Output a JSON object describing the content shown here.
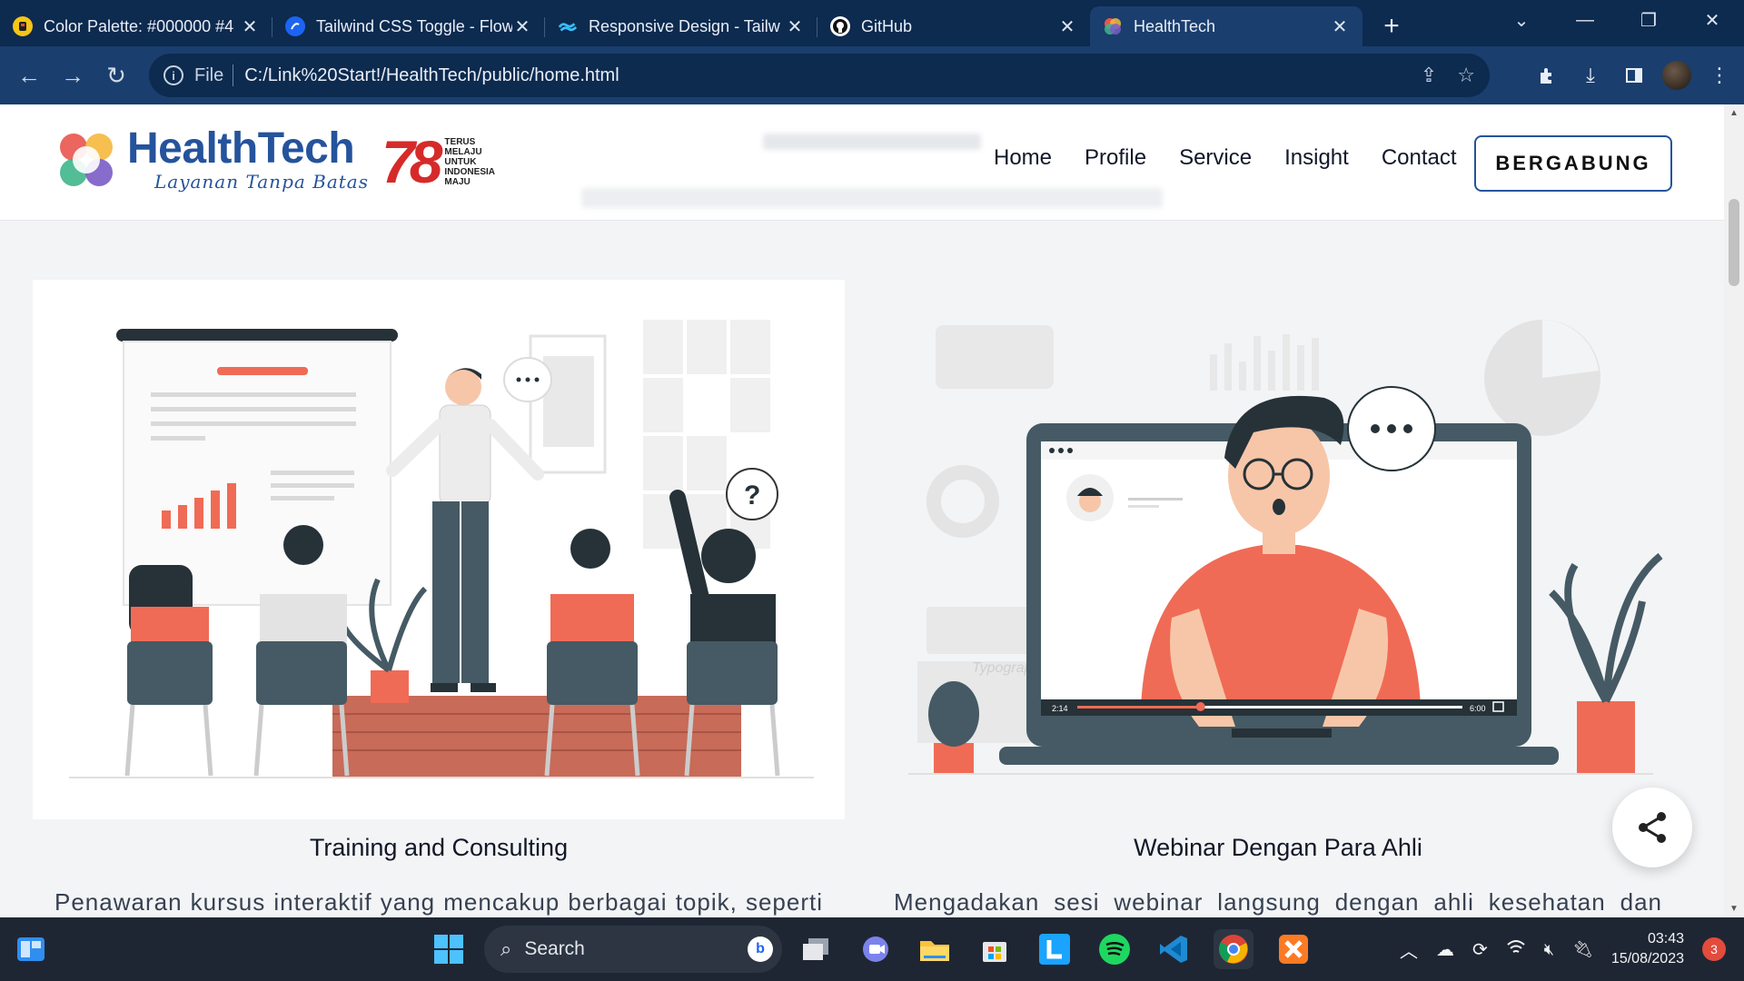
{
  "browser": {
    "tabs": [
      {
        "title": "Color Palette: #000000 #4",
        "favicon": "color-palette-favicon",
        "active": false
      },
      {
        "title": "Tailwind CSS Toggle - Flow",
        "favicon": "flowbite-favicon",
        "active": false
      },
      {
        "title": "Responsive Design - Tailw",
        "favicon": "tailwind-favicon",
        "active": false
      },
      {
        "title": "GitHub",
        "favicon": "github-favicon",
        "active": false
      },
      {
        "title": "HealthTech",
        "favicon": "healthtech-favicon",
        "active": true
      }
    ],
    "address": {
      "scheme_label": "File",
      "url": "C:/Link%20Start!/HealthTech/public/home.html"
    }
  },
  "site": {
    "logo": {
      "brand": "HealthTech",
      "tagline": "Layanan Tanpa Batas"
    },
    "anniversary": {
      "number": "78",
      "line1": "TERUS",
      "line2": "MELAJU",
      "line3": "UNTUK",
      "line4": "INDONESIA",
      "line5": "MAJU"
    },
    "nav": {
      "home": "Home",
      "profile": "Profile",
      "service": "Service",
      "insight": "Insight",
      "contact": "Contact",
      "join": "BERGABUNG"
    },
    "cards": [
      {
        "title": "Training and Consulting",
        "description": "Penawaran kursus interaktif yang mencakup berbagai topik, seperti"
      },
      {
        "title": "Webinar Dengan Para Ahli",
        "description": "Mengadakan sesi webinar langsung dengan ahli kesehatan dan"
      }
    ],
    "video": {
      "current_time": "2:14",
      "duration": "6:00",
      "progress": 0.32
    },
    "illustration_text": "Typography"
  },
  "taskbar": {
    "search_label": "Search",
    "time": "03:43",
    "date": "15/08/2023",
    "notification_count": "3"
  },
  "colors": {
    "brand_blue": "#25539c",
    "accent_coral": "#f06b55",
    "chrome_dark": "#0d2a4f",
    "chrome_toolbar": "#1a3e6e"
  }
}
